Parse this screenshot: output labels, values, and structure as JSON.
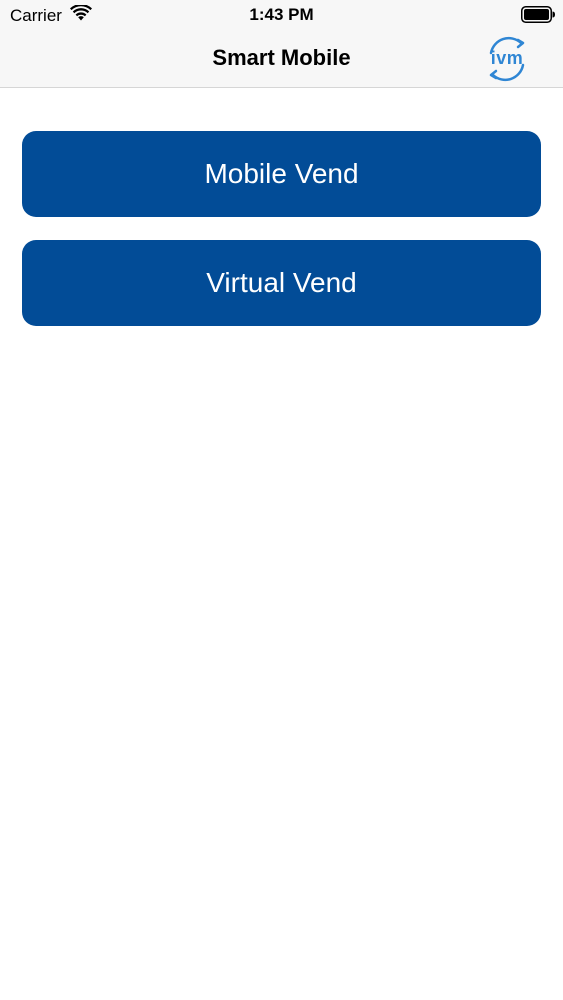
{
  "status_bar": {
    "carrier": "Carrier",
    "time": "1:43 PM",
    "wifi_icon": "wifi-icon",
    "battery_icon": "battery-icon"
  },
  "nav_bar": {
    "title": "Smart Mobile",
    "logo_text": "ivm"
  },
  "menu": {
    "items": [
      {
        "label": "Mobile Vend"
      },
      {
        "label": "Virtual Vend"
      }
    ]
  },
  "colors": {
    "button_background": "#024c97",
    "button_text": "#ffffff",
    "logo_accent": "#2f86d4",
    "bar_background": "#f7f7f7"
  }
}
